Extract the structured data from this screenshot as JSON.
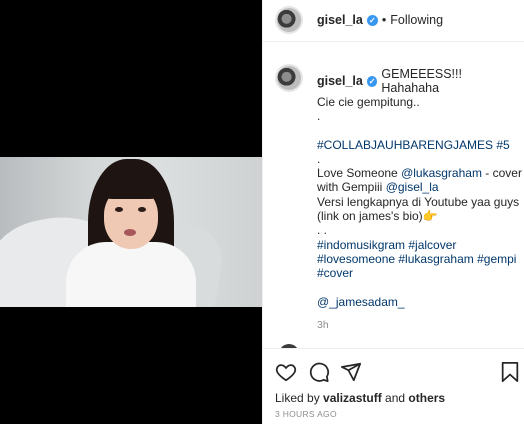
{
  "post": {
    "username": "gisel_la",
    "follow_status": "Following",
    "separator": "•"
  },
  "caption": {
    "username": "gisel_la",
    "headline": "GEMEEESS!!! Hahahaha",
    "lines": [
      {
        "text": "Cie cie gempitung..",
        "kind": "text"
      },
      {
        "text": ".",
        "kind": "text"
      },
      {
        "text": "",
        "kind": "gap"
      },
      {
        "text": "#COLLABJAUHBARENGJAMES #5",
        "kind": "link"
      },
      {
        "text": ".",
        "kind": "text"
      },
      {
        "text": "Love Someone",
        "kind": "mixed",
        "link": "@lukasgraham",
        "after": " - cover"
      },
      {
        "text": "with Gempiii",
        "kind": "mixed",
        "link": "@gisel_la",
        "after": ""
      },
      {
        "text": "Versi lengkapnya di Youtube yaa guys",
        "kind": "text"
      },
      {
        "text": "(link on james's bio)👉",
        "kind": "text"
      },
      {
        "text": ". .",
        "kind": "text"
      },
      {
        "text": "#indomusikgram #jalcover",
        "kind": "link"
      },
      {
        "text": "#lovesomeone #lukasgraham #gempi",
        "kind": "link"
      },
      {
        "text": "#cover",
        "kind": "link"
      },
      {
        "text": "",
        "kind": "gap"
      },
      {
        "text": "@_jamesadam_",
        "kind": "link"
      }
    ],
    "time": "3h"
  },
  "footer": {
    "liked_by_prefix": "Liked by ",
    "liked_by_user": "valizastuff",
    "liked_by_suffix": " and ",
    "liked_by_others": "others",
    "posted_time": "3 HOURS AGO"
  },
  "icons": {
    "like": "heart-icon",
    "comment": "comment-icon",
    "share": "share-icon",
    "save": "bookmark-icon",
    "verified": "verified-badge-icon"
  },
  "colors": {
    "link": "#00376b",
    "verified": "#3897f0",
    "muted": "#8e8e8e"
  }
}
